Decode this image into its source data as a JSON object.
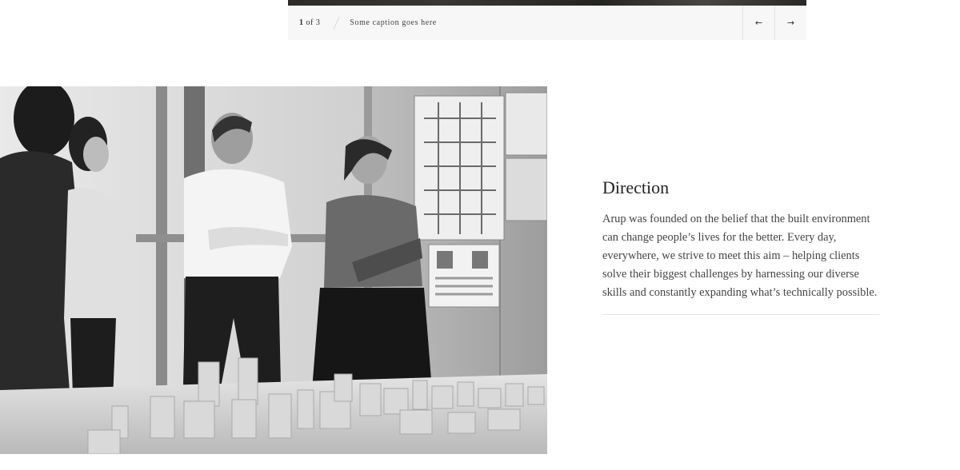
{
  "carousel": {
    "current": "1",
    "of_label": "of 3",
    "caption": "Some caption goes here",
    "prev_icon": "arrow-left-icon",
    "next_icon": "arrow-right-icon",
    "prev_glyph": "←",
    "next_glyph": "→"
  },
  "section": {
    "heading": "Direction",
    "body": "Arup was founded on the belief that the built environment can change people’s lives for the better. Every day, everywhere, we strive to meet this aim – helping clients solve their biggest challenges by harnessing our diverse skills and constantly expanding what’s technically possible."
  }
}
